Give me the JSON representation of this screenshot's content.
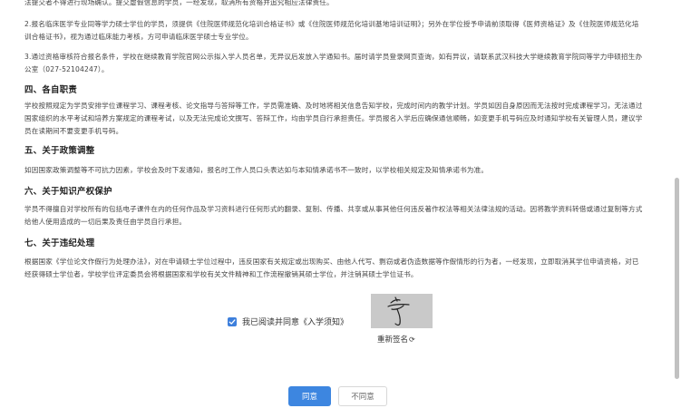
{
  "paragraphs": {
    "p0_cut": "法提交者不得进行现场确认。提交虚假信息的学员，一经发现，取消所有资格并追究相应法律责任。",
    "p2": "2.报名临床医学专业同等学力硕士学位的学员，须提供《住院医师规范化培训合格证书》或《住院医师规范化培训基地培训证明》；另外在学位授予申请前须取得《医师资格证》及《住院医师规范化培训合格证书》，视为通过临床能力考核，方可申请临床医学硕士专业学位。",
    "p3": "3.通过资格审核符合报名条件，学校在继续教育学院官网公示拟入学人员名单，无异议后发放入学通知书。届时请学员登录网页查询，如有异议，请联系武汉科技大学继续教育学院同等学力申硕招生办公室（027-52104247）。",
    "h4": "四、各自职责",
    "p4": "学校按照规定为学员安排学位课程学习、课程考核、论文指导与答辩等工作，学员需准确、及时地将相关信息告知学校，完成时间内的教学计划。学员如因自身原因而无法按时完成课程学习，无法通过国家组织的水平考试和培养方案规定的课程考试，以及无法完成论文撰写、答辩工作，均由学员自行承担责任。学员报名入学后应确保通信顺畅，如变更手机号码应及时通知学校有关管理人员，建议学员在读期间不要变更手机号码。",
    "h5": "五、关于政策调整",
    "p5": "如因国家政策调整等不可抗力因素，学校会及时下发通知，报名时工作人员口头表达如与本知情承诺书不一致时，以学校相关规定及知情承诺书为准。",
    "h6": "六、关于知识产权保护",
    "p6": "学员不得擅自对学校所有的包括电子课件在内的任何作品及学习资料进行任何形式的翻录、复制、传播、共享或从事其他任何违反著作权法等相关法律法规的活动。因将教学资料转借或通过复制等方式给他人使用造成的一切后果及责任由学员自行承担。",
    "h7": "七、关于违纪处理",
    "p7": "根据国家《学位论文作假行为处理办法》，对在申请硕士学位过程中，违反国家有关规定或出现购买、由他人代写、剽窃或者伪造数据等作假情形的行为者，一经发现，立即取消其学位申请资格，对已经获得硕士学位者，学校学位评定委员会将根据国家和学校有关文件精神和工作流程撤销其硕士学位，并注销其硕士学位证书。"
  },
  "agreement": {
    "checked": true,
    "label": "我已阅读并同意《入学须知》"
  },
  "signature": {
    "resign_label": "重新签名",
    "refresh_icon": "refresh-icon"
  },
  "buttons": {
    "agree": "同意",
    "disagree": "不同意"
  },
  "colors": {
    "primary": "#3d86e0",
    "checkbox": "#3d7fdc",
    "signature_bg": "#c9c9c9"
  }
}
